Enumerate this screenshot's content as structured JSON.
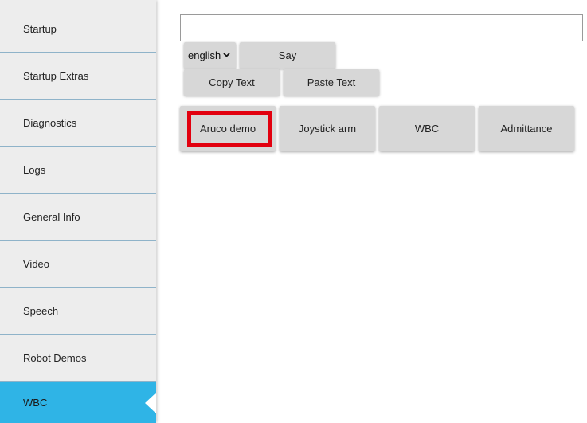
{
  "sidebar": {
    "items": [
      {
        "label": "Startup"
      },
      {
        "label": "Startup Extras"
      },
      {
        "label": "Diagnostics"
      },
      {
        "label": "Logs"
      },
      {
        "label": "General Info"
      },
      {
        "label": "Video"
      },
      {
        "label": "Speech"
      },
      {
        "label": "Robot Demos"
      },
      {
        "label": "WBC"
      }
    ],
    "active_item": "WBC",
    "active_color": "#2fb4e6"
  },
  "speech": {
    "text_value": "",
    "language_selected": "english",
    "say_label": "Say",
    "copy_label": "Copy Text",
    "paste_label": "Paste Text"
  },
  "wbc": {
    "buttons": [
      {
        "label": "Aruco demo"
      },
      {
        "label": "Joystick arm"
      },
      {
        "label": "WBC"
      },
      {
        "label": "Admittance"
      }
    ],
    "highlighted": "Aruco demo",
    "highlight_color": "#e2000f"
  }
}
